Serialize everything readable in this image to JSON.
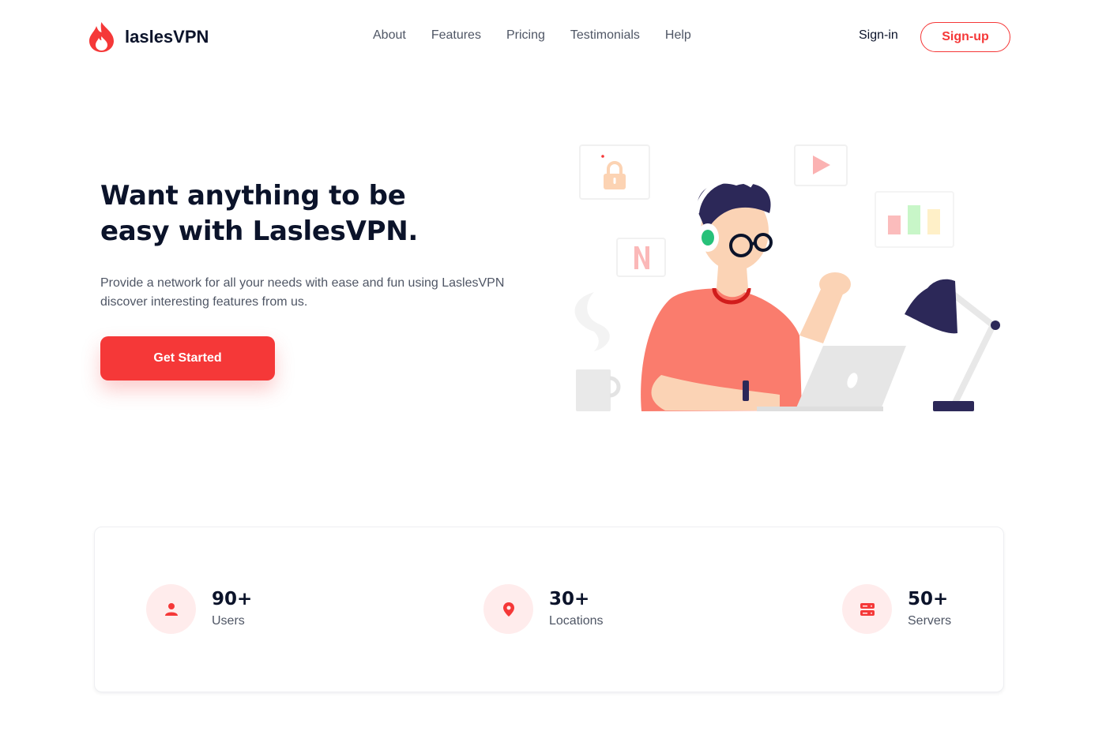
{
  "brand": {
    "name": "laslesVPN",
    "accent": "#f53838"
  },
  "nav": {
    "items": [
      {
        "label": "About"
      },
      {
        "label": "Features"
      },
      {
        "label": "Pricing"
      },
      {
        "label": "Testimonials"
      },
      {
        "label": "Help"
      }
    ],
    "signin_label": "Sign-in",
    "signup_label": "Sign-up"
  },
  "hero": {
    "title_line1": "Want anything to be",
    "title_line2": "easy with LaslesVPN.",
    "desc_line1": "Provide a network for all your needs with ease and fun using LaslesVPN",
    "desc_line2": "discover interesting features from us.",
    "cta_label": "Get Started",
    "illustration_icons": [
      "lock-icon",
      "play-icon",
      "bar-chart-icon",
      "netflix-icon",
      "coffee-mug-icon",
      "desk-lamp-icon",
      "laptop-icon"
    ]
  },
  "stats": [
    {
      "icon": "user-icon",
      "value": "90+",
      "label": "Users"
    },
    {
      "icon": "location-pin-icon",
      "value": "30+",
      "label": "Locations"
    },
    {
      "icon": "server-icon",
      "value": "50+",
      "label": "Servers"
    }
  ]
}
